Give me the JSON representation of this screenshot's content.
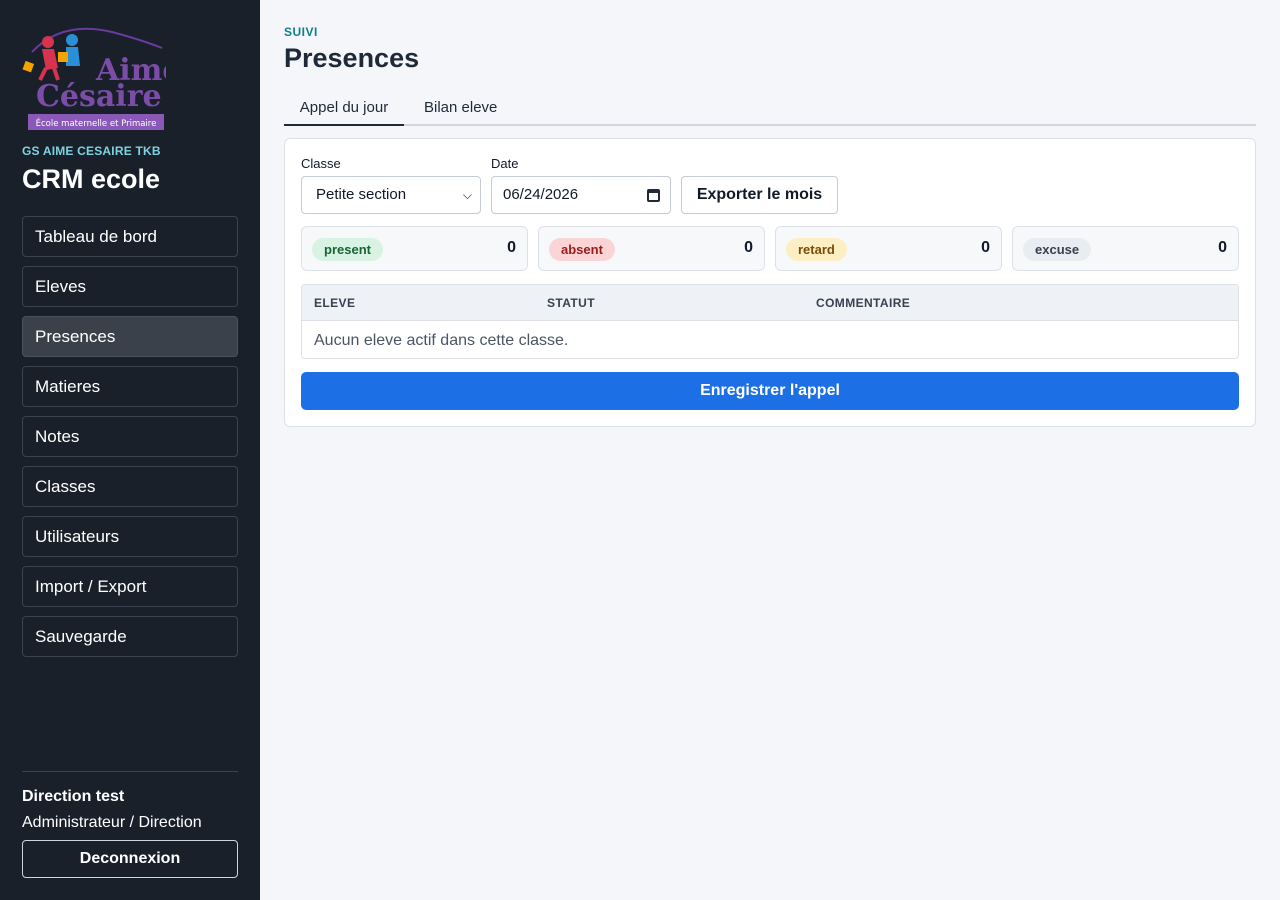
{
  "sidebar": {
    "logo": {
      "line1": "Aimé",
      "line2": "Césaire",
      "tagline": "École maternelle et Primaire"
    },
    "school_name": "GS AIME CESAIRE TKB",
    "app_title": "CRM ecole",
    "items": [
      {
        "label": "Tableau de bord",
        "active": false
      },
      {
        "label": "Eleves",
        "active": false
      },
      {
        "label": "Presences",
        "active": true
      },
      {
        "label": "Matieres",
        "active": false
      },
      {
        "label": "Notes",
        "active": false
      },
      {
        "label": "Classes",
        "active": false
      },
      {
        "label": "Utilisateurs",
        "active": false
      },
      {
        "label": "Import / Export",
        "active": false
      },
      {
        "label": "Sauvegarde",
        "active": false
      }
    ],
    "user": {
      "name": "Direction test",
      "role": "Administrateur / Direction"
    },
    "logout_label": "Deconnexion"
  },
  "header": {
    "kicker": "SUIVI",
    "title": "Presences"
  },
  "tabs": [
    {
      "label": "Appel du jour",
      "active": true
    },
    {
      "label": "Bilan eleve",
      "active": false
    }
  ],
  "filters": {
    "class_label": "Classe",
    "class_value": "Petite section",
    "date_label": "Date",
    "date_value": "06/24/2026",
    "export_label": "Exporter le mois"
  },
  "stats": [
    {
      "label": "present",
      "count": "0",
      "bg": "#d8f3e3",
      "fg": "#166534"
    },
    {
      "label": "absent",
      "count": "0",
      "bg": "#fbd5d5",
      "fg": "#9b1c1c"
    },
    {
      "label": "retard",
      "count": "0",
      "bg": "#fdefc3",
      "fg": "#7a4a06"
    },
    {
      "label": "excuse",
      "count": "0",
      "bg": "#e9edf2",
      "fg": "#374151"
    }
  ],
  "table": {
    "headers": [
      "ELEVE",
      "STATUT",
      "COMMENTAIRE"
    ],
    "empty_message": "Aucun eleve actif dans cette classe."
  },
  "save_label": "Enregistrer l'appel",
  "colors": {
    "sidebar_bg": "#19202a",
    "accent": "#1d6fe6",
    "kicker": "#0e7f8c",
    "school_name": "#7fd3e0"
  }
}
